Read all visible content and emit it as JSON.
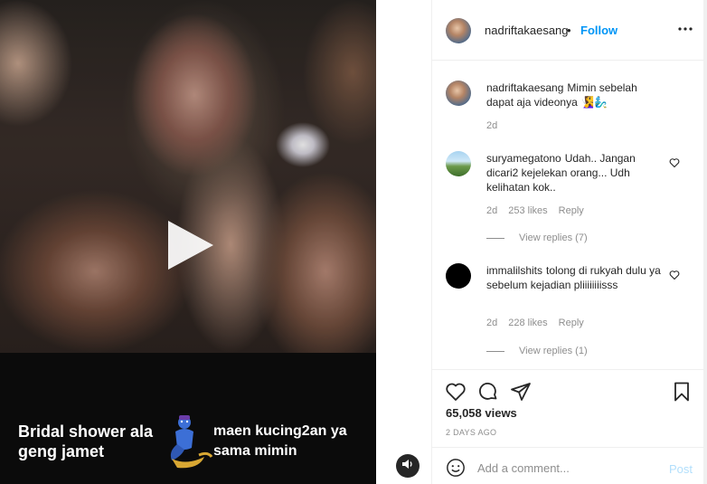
{
  "media": {
    "caption_left": "Bridal shower ala geng jamet",
    "caption_right": "maen kucing2an ya sama mimin",
    "play_icon": "play-icon",
    "mute_icon": "speaker-icon"
  },
  "header": {
    "username": "nadriftakaesang",
    "separator": "•",
    "follow_label": "Follow",
    "more_icon": "more-horizontal-icon"
  },
  "caption_comment": {
    "username": "nadriftakaesang",
    "text": "Mimin sebelah dapat aja videonya 🧏‍♀️🧞‍♂️",
    "time": "2d"
  },
  "comments": [
    {
      "username": "suryamegatono",
      "text": "Udah.. Jangan dicari2 kejelekan orang... Udh kelihatan kok..",
      "time": "2d",
      "likes": "253 likes",
      "reply_label": "Reply",
      "view_replies": "View replies (7)"
    },
    {
      "username": "immalilshits",
      "text": "tolong di rukyah dulu ya sebelum kejadian pliiiiiiiisss",
      "time": "2d",
      "likes": "228 likes",
      "reply_label": "Reply",
      "view_replies": "View replies (1)"
    }
  ],
  "actions": {
    "views": "65,058 views",
    "date": "2 DAYS AGO"
  },
  "add_comment": {
    "placeholder": "Add a comment...",
    "post_label": "Post"
  },
  "colors": {
    "accent": "#0095f6",
    "muted": "#8e8e8e",
    "text": "#262626",
    "post_disabled": "#b2dffc"
  }
}
